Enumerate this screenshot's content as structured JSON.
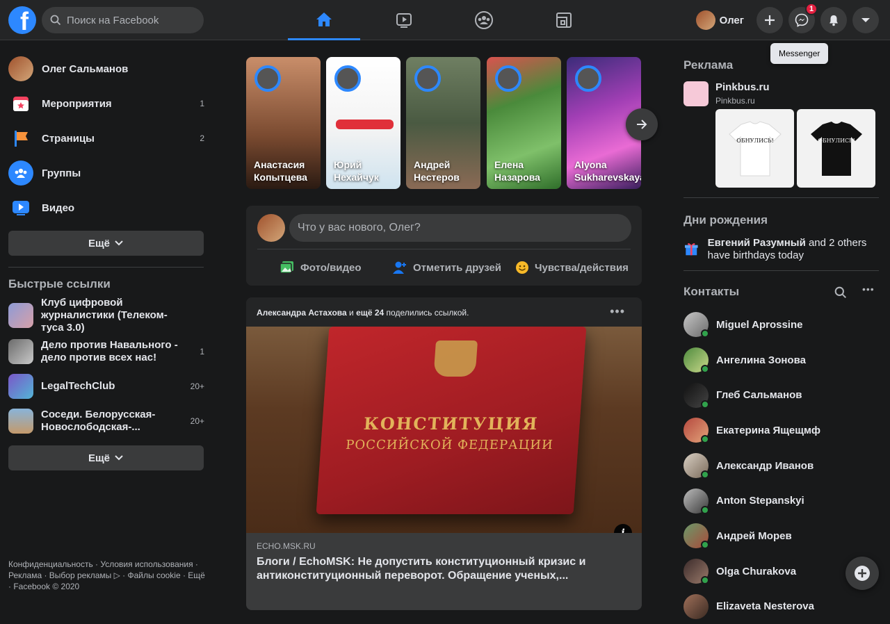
{
  "header": {
    "search_placeholder": "Поиск на Facebook",
    "profile_name": "Олег",
    "notification_badge": "1",
    "tooltip": "Messenger",
    "accent": "#2d88ff"
  },
  "left": {
    "user_name": "Олег Сальманов",
    "items": [
      {
        "label": "Мероприятия",
        "count": "1",
        "icon": "calendar-icon"
      },
      {
        "label": "Страницы",
        "count": "2",
        "icon": "flag-icon"
      },
      {
        "label": "Группы",
        "count": "",
        "icon": "groups-icon"
      },
      {
        "label": "Видео",
        "count": "",
        "icon": "video-icon"
      }
    ],
    "more_label": "Ещё",
    "quick_links_title": "Быстрые ссылки",
    "quick_links": [
      {
        "label": "Клуб цифровой журналистики (Телеком-туса 3.0)",
        "count": ""
      },
      {
        "label": "Дело против Навального - дело против всех нас!",
        "count": "1"
      },
      {
        "label": "LegalTechClub",
        "count": "20+"
      },
      {
        "label": "Соседи. Белорусская-Новослободская-...",
        "count": "20+"
      }
    ],
    "more_label2": "Ещё",
    "footer": "Конфиденциальность · Условия использования · Реклама · Выбор рекламы ▷ · Файлы cookie · Ещё · Facebook © 2020"
  },
  "stories": [
    {
      "name": "Анастасия Копытцева"
    },
    {
      "name": "Юрий Нехайчук"
    },
    {
      "name": "Андрей Нестеров"
    },
    {
      "name": "Елена Назарова"
    },
    {
      "name": "Alyona Sukharevskaya"
    }
  ],
  "composer": {
    "placeholder": "Что у вас нового, Олег?",
    "actions": [
      "Фото/видео",
      "Отметить друзей",
      "Чувства/действия"
    ]
  },
  "post": {
    "actor": "Александра Астахова",
    "mid": " и ",
    "others": "ещё 24",
    "tail": " поделились ссылкой.",
    "image_line1": "КОНСТИТУЦИЯ",
    "image_line2": "РОССИЙСКОЙ ФЕДЕРАЦИИ",
    "domain": "ECHO.MSK.RU",
    "title": "Блоги / EchoMSK: Не допустить конституционный кризис и антиконституционный переворот. Обращение ученых,..."
  },
  "right": {
    "ads_title": "Реклама",
    "ad_name": "Pinkbus.ru",
    "ad_sub": "Pinkbus.ru",
    "ad_shirt_text": "ОБНУЛИСЬ!",
    "birthdays_title": "Дни рождения",
    "birthday_name": "Евгений Разумный",
    "birthday_text": " and 2 others have birthdays today",
    "contacts_title": "Контакты",
    "contacts": [
      "Miguel Aprossine",
      "Ангелина Зонова",
      "Глеб Сальманов",
      "Екатерина Ящещмф",
      "Александр Иванов",
      "Anton Stepanskyi",
      "Андрей Морев",
      "Olga Churakova",
      "Elizaveta Nesterova"
    ]
  }
}
